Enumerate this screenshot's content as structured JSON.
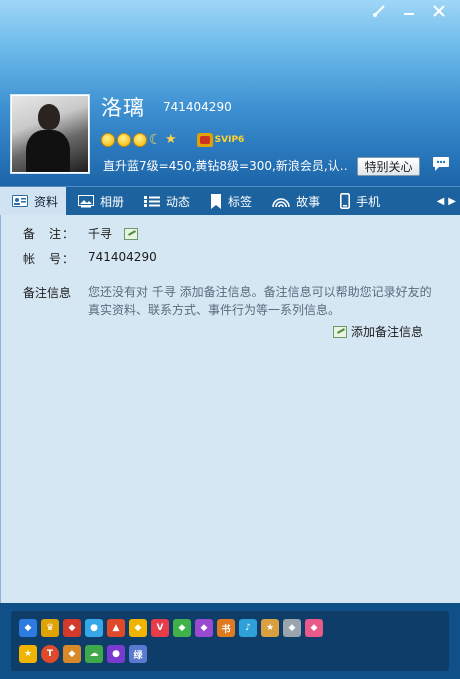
{
  "profile": {
    "nickname": "洛璃",
    "qq_number": "741404290",
    "status_text": "直升蓝7级=450,黄钻8级=300,新浪会员,认…",
    "svip_label": "SVIP6",
    "special_care_label": "特别关心"
  },
  "tabs": [
    {
      "label": "资料",
      "icon": "profile-card-icon"
    },
    {
      "label": "相册",
      "icon": "photo-album-icon"
    },
    {
      "label": "动态",
      "icon": "feed-list-icon"
    },
    {
      "label": "标签",
      "icon": "bookmark-tag-icon"
    },
    {
      "label": "故事",
      "icon": "rainbow-story-icon"
    },
    {
      "label": "手机",
      "icon": "mobile-phone-icon"
    }
  ],
  "info": {
    "remark_label": "备　注：",
    "remark_value": "千寻",
    "account_label": "帐　号：",
    "account_value": "741404290",
    "note_label": "备注信息",
    "note_description": "您还没有对 千寻 添加备注信息。备注信息可以帮助您记录好友的真实资料、联系方式、事件行为等一系列信息。",
    "add_note_label": "添加备注信息"
  },
  "colors": {
    "titlebar_top": "#9fd6f7",
    "header_bottom": "#1d65a8",
    "tab_active_bg": "#cfe3f3",
    "content_bg": "#d6e7f4",
    "bottom_bg": "#0f5088"
  },
  "service_icons_row1": [
    "blue-diamond-icon",
    "svip-crown-icon",
    "red-diamond-icon",
    "pet-icon",
    "game-icon",
    "yellow-diamond-icon",
    "vip-icon",
    "green-diamond-icon",
    "purple-diamond-icon",
    "book-icon",
    "music-icon",
    "qzone-icon",
    "gray-diamond-icon",
    "pink-diamond-icon"
  ],
  "service_icons_row2": [
    "star-icon",
    "tencent-video-icon",
    "game-vip-icon",
    "weiyun-icon",
    "purple-game-icon",
    "qq-music-icon"
  ],
  "service_text": {
    "last_icon": "绿"
  }
}
